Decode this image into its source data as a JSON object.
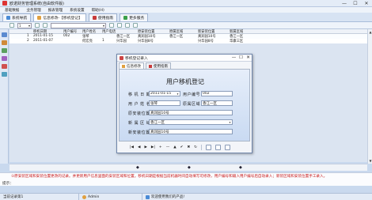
{
  "window": {
    "title": "欧诺财务管理系统(自由软件版)",
    "minimize": "—",
    "maximize": "☐",
    "close": "✕"
  },
  "menu": [
    "基础数据",
    "业务管理",
    "报表管理",
    "系统设置",
    "帮助(H)"
  ],
  "tabs": [
    {
      "label": "系统导航",
      "icon_color": "#4a8bd6"
    },
    {
      "label": "信息修改-【移机登记】",
      "icon_color": "#e0a040"
    },
    {
      "label": "使用指南",
      "icon_color": "#c83a3a"
    },
    {
      "label": "更多服务",
      "icon_color": "#3aa04a"
    }
  ],
  "toolbar": {
    "page_select": "1",
    "filter_select": ""
  },
  "grid": {
    "headers": [
      "移机日期",
      "用户编号",
      "用户姓名",
      "用户电话",
      "原安装位置",
      "原属区域",
      "新安装位置",
      "新属区域"
    ],
    "rows": [
      [
        "1",
        "2011-01-15",
        "002",
        "张琴",
        "",
        "香江一区",
        "真润园10号",
        "香江一区",
        "真润园10号",
        "香江一区"
      ],
      [
        "2",
        "2011-01-07",
        "",
        "何宏亮",
        "1",
        "兴华园",
        "兴华园8号",
        "",
        "兴华园8号",
        "华康三区"
      ]
    ]
  },
  "dialog": {
    "title": "移机登记录入",
    "tabs": [
      "信息修改",
      "使用指南"
    ],
    "form_title": "用户移机登记",
    "fields": {
      "date_label": "移 机 日 期",
      "date_value": "2011-01-15",
      "user_no_label": "用户编号",
      "user_no_value": "002",
      "name_label": "用 户 姓 名",
      "name_value": "张琴",
      "area_label": "原属区域",
      "area_value": "香江一区",
      "old_pos_label": "原安装位置",
      "old_pos_value": "真润园10号",
      "new_area_label": "新 属 区 域",
      "new_area_value": "香江一区",
      "new_pos_label": "新安装位置",
      "new_pos_value": "真润园10号"
    },
    "nav": [
      "|◀",
      "◀",
      "▶",
      "▶|",
      "+",
      "—",
      "▲",
      "✔",
      "✖",
      "↻"
    ]
  },
  "hint": {
    "text": "①原安装区域和安装位置更改的记录。并更新用户信息里面的安装区域和位置。移机日期是根据当前机器时间自动填写可修改，用户编号和输入用户编号后自动录入；新装区域和安装位置手工录入。",
    "label": "提示："
  },
  "status": {
    "app": "当前记录第1",
    "user_icon": "user-icon",
    "user": "Admin",
    "welcome": "欢迎使用我们的产品!"
  },
  "colors": {
    "accent": "#4a72b0",
    "hint": "#c81818"
  }
}
